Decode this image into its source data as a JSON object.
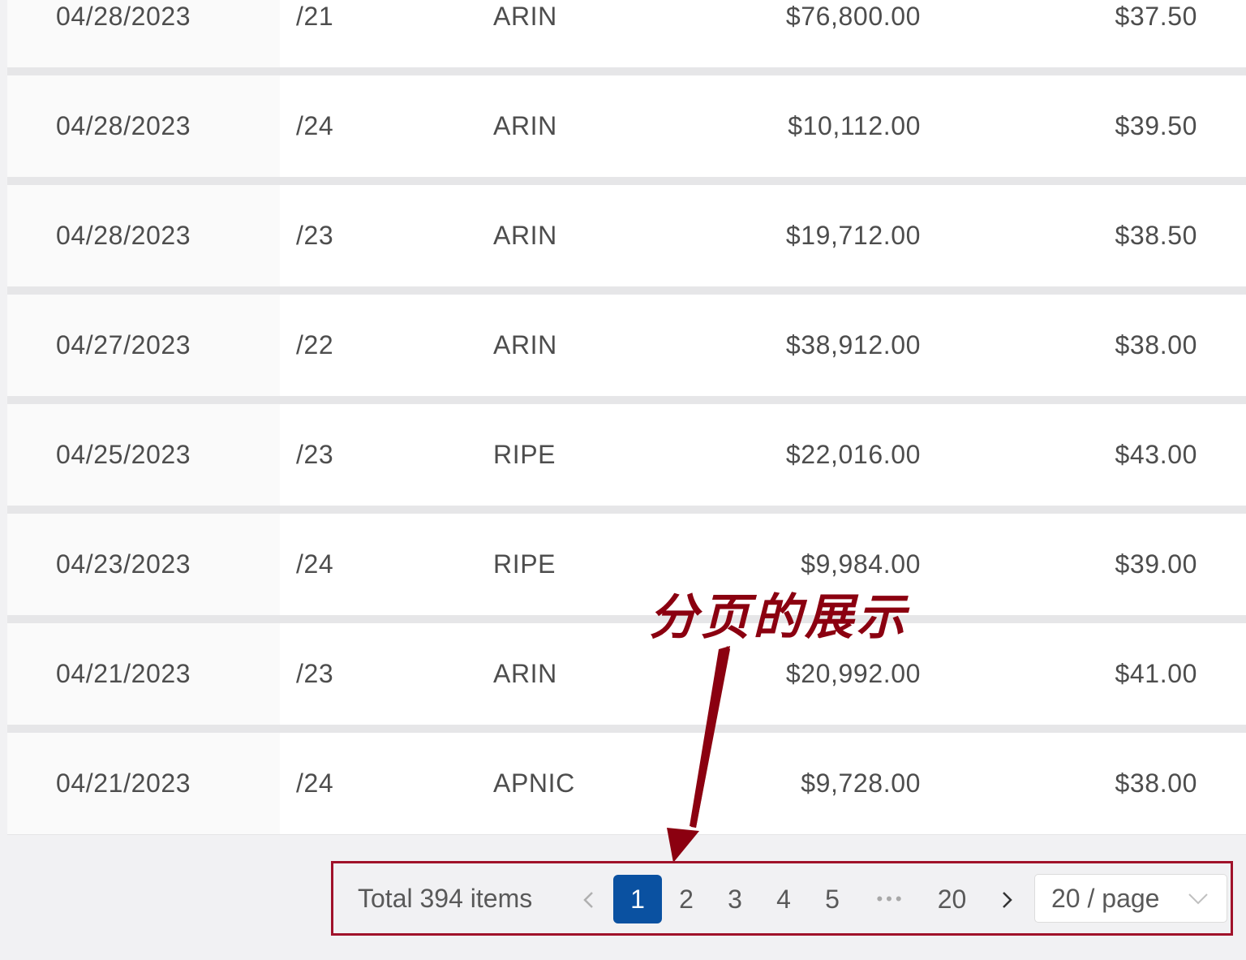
{
  "table": {
    "rows": [
      {
        "date": "04/28/2023",
        "prefix": "/21",
        "rir": "ARIN",
        "price": "$76,800.00",
        "unit_price": "$37.50"
      },
      {
        "date": "04/28/2023",
        "prefix": "/24",
        "rir": "ARIN",
        "price": "$10,112.00",
        "unit_price": "$39.50"
      },
      {
        "date": "04/28/2023",
        "prefix": "/23",
        "rir": "ARIN",
        "price": "$19,712.00",
        "unit_price": "$38.50"
      },
      {
        "date": "04/27/2023",
        "prefix": "/22",
        "rir": "ARIN",
        "price": "$38,912.00",
        "unit_price": "$38.00"
      },
      {
        "date": "04/25/2023",
        "prefix": "/23",
        "rir": "RIPE",
        "price": "$22,016.00",
        "unit_price": "$43.00"
      },
      {
        "date": "04/23/2023",
        "prefix": "/24",
        "rir": "RIPE",
        "price": "$9,984.00",
        "unit_price": "$39.00"
      },
      {
        "date": "04/21/2023",
        "prefix": "/23",
        "rir": "ARIN",
        "price": "$20,992.00",
        "unit_price": "$41.00"
      },
      {
        "date": "04/21/2023",
        "prefix": "/24",
        "rir": "APNIC",
        "price": "$9,728.00",
        "unit_price": "$38.00"
      }
    ]
  },
  "annotation": {
    "text": "分页的展示",
    "color": "#8b0010"
  },
  "pagination": {
    "total_label": "Total 394 items",
    "prev_icon": "chevron-left-icon",
    "next_icon": "chevron-right-icon",
    "pages": [
      "1",
      "2",
      "3",
      "4",
      "5"
    ],
    "active_page": "1",
    "ellipsis": "•••",
    "last_page": "20",
    "page_size_label": "20 / page",
    "accent_color": "#0a51a1",
    "highlight_color": "#a0122a"
  }
}
